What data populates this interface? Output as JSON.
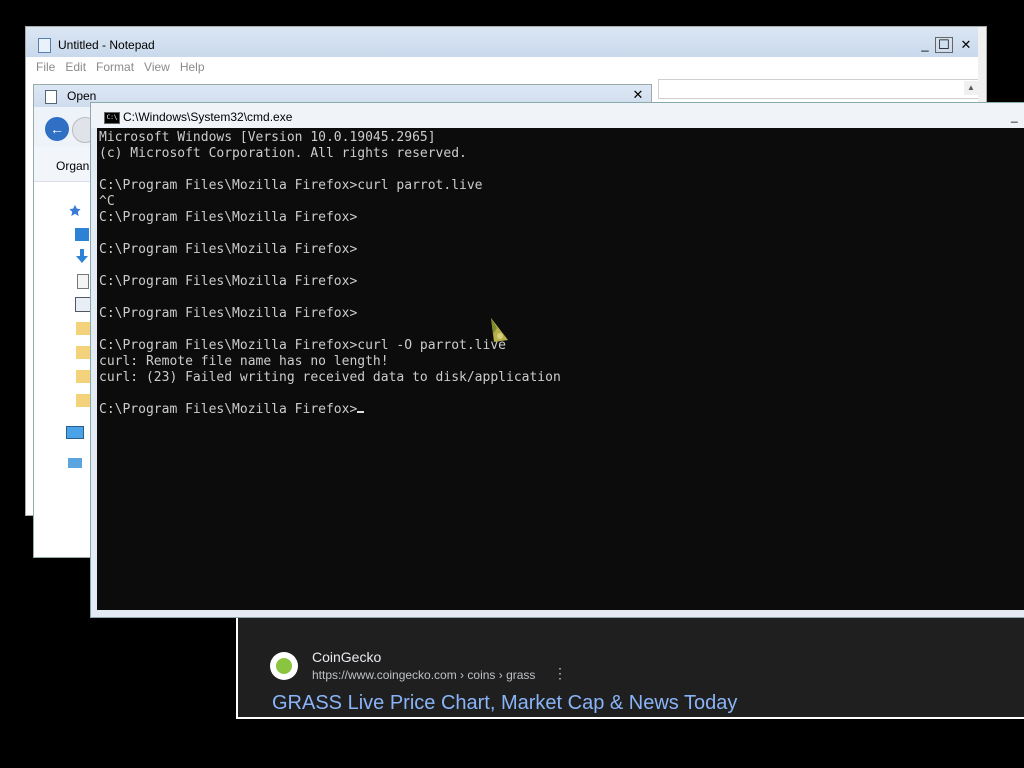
{
  "browser": {
    "site_name": "CoinGecko",
    "site_url": "https://www.coingecko.com › coins › grass",
    "result_title": "GRASS Live Price Chart, Market Cap & News Today",
    "kebab": "⋮"
  },
  "notepad": {
    "title": "Untitled - Notepad",
    "menu": [
      "File",
      "Edit",
      "Format",
      "View",
      "Help"
    ],
    "btn_min": "_",
    "btn_max": "☐",
    "btn_close": "✕",
    "scroll_up": "▲"
  },
  "open_dialog": {
    "title": "Open",
    "close": "✕",
    "back": "←",
    "organize_label": "Organ"
  },
  "cmd": {
    "title": "C:\\Windows\\System32\\cmd.exe",
    "icon_text": "C:\\",
    "lines": [
      "Microsoft Windows [Version 10.0.19045.2965]",
      "(c) Microsoft Corporation. All rights reserved.",
      "",
      "C:\\Program Files\\Mozilla Firefox>curl parrot.live",
      "^C",
      "C:\\Program Files\\Mozilla Firefox>",
      "",
      "C:\\Program Files\\Mozilla Firefox>",
      "",
      "C:\\Program Files\\Mozilla Firefox>",
      "",
      "C:\\Program Files\\Mozilla Firefox>",
      "",
      "C:\\Program Files\\Mozilla Firefox>curl -O parrot.live",
      "curl: Remote file name has no length!",
      "curl: (23) Failed writing received data to disk/application",
      ""
    ],
    "prompt": "C:\\Program Files\\Mozilla Firefox>"
  }
}
